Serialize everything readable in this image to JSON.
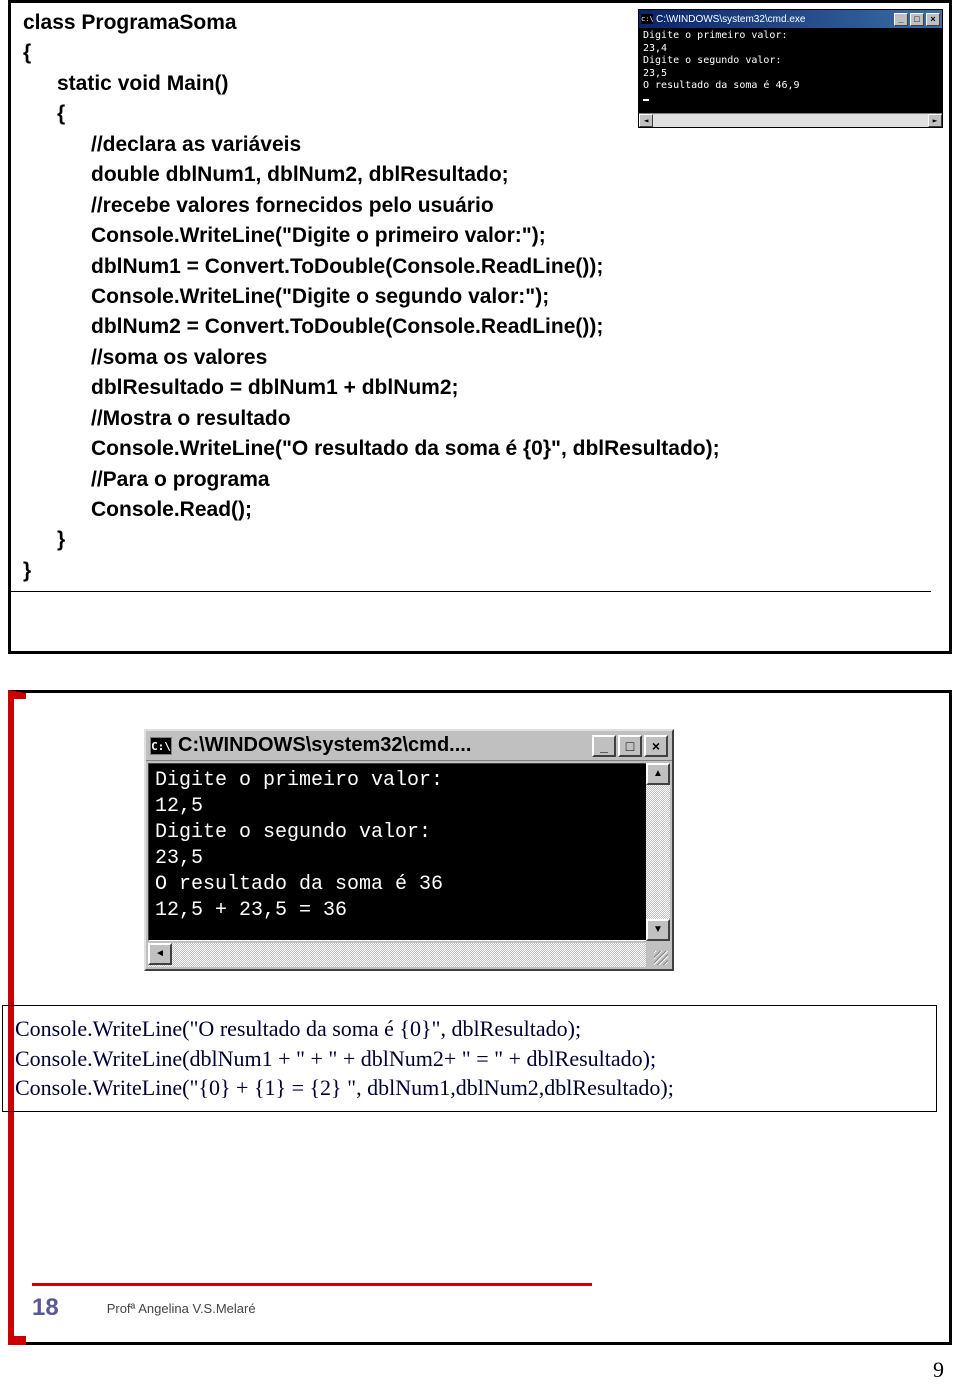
{
  "slide1": {
    "code": {
      "l1": "class ProgramaSoma",
      "l2": "{",
      "l3": "static void Main()",
      "l4": "{",
      "l5": "//declara as variáveis",
      "l6": "double dblNum1, dblNum2, dblResultado;",
      "l7": "//recebe valores fornecidos pelo usuário",
      "l8": "Console.WriteLine(\"Digite o primeiro valor:\");",
      "l9": "dblNum1 = Convert.ToDouble(Console.ReadLine());",
      "l10": "Console.WriteLine(\"Digite o segundo valor:\");",
      "l11": "dblNum2 = Convert.ToDouble(Console.ReadLine());",
      "l12": "//soma os valores",
      "l13": "dblResultado = dblNum1 + dblNum2;",
      "l14": "//Mostra o resultado",
      "l15": "Console.WriteLine(\"O resultado da soma é {0}\", dblResultado);",
      "l16": "//Para o programa",
      "l17": "Console.Read();",
      "l18": "}",
      "l19": "}"
    },
    "console": {
      "title": "C:\\WINDOWS\\system32\\cmd.exe",
      "body": "Digite o primeiro valor:\n23,4\nDigite o segundo valor:\n23,5\nO resultado da soma é 46,9"
    }
  },
  "slide2": {
    "console": {
      "title": "C:\\WINDOWS\\system32\\cmd....",
      "body": "Digite o primeiro valor:\n12,5\nDigite o segundo valor:\n23,5\nO resultado da soma é 36\n12,5 + 23,5 = 36"
    },
    "code": {
      "l1": "Console.WriteLine(\"O resultado da soma é {0}\", dblResultado);",
      "l2": "Console.WriteLine(dblNum1 + \" + \" + dblNum2+ \" = \" + dblResultado);",
      "l3": "Console.WriteLine(\"{0} + {1} = {2} \", dblNum1,dblNum2,dblResultado);"
    },
    "footer": {
      "num": "18",
      "credit": "Profª Angelina V.S.Melaré"
    }
  },
  "page_number": "9",
  "win_btns": {
    "min": "_",
    "max": "□",
    "close": "×"
  },
  "arrows": {
    "left": "◄",
    "right": "►",
    "up": "▲",
    "down": "▼"
  }
}
